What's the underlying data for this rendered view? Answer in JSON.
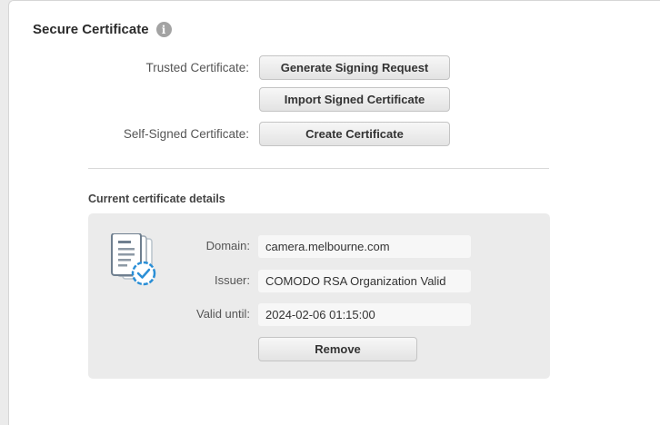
{
  "section": {
    "title": "Secure Certificate",
    "info_icon_glyph": "i"
  },
  "trusted": {
    "label": "Trusted Certificate:",
    "generate_button": "Generate Signing Request",
    "import_button": "Import Signed Certificate"
  },
  "self_signed": {
    "label": "Self-Signed Certificate:",
    "create_button": "Create Certificate"
  },
  "details": {
    "heading": "Current certificate details",
    "domain_label": "Domain:",
    "domain_value": "camera.melbourne.com",
    "issuer_label": "Issuer:",
    "issuer_value": "COMODO RSA Organization Valid",
    "valid_label": "Valid until:",
    "valid_value": "2024-02-06 01:15:00",
    "remove_button": "Remove",
    "icon": "certificate-verified-icon"
  },
  "colors": {
    "accent_blue": "#2b8fd6",
    "panel_background": "#ffffff",
    "details_background": "#ebebeb"
  }
}
